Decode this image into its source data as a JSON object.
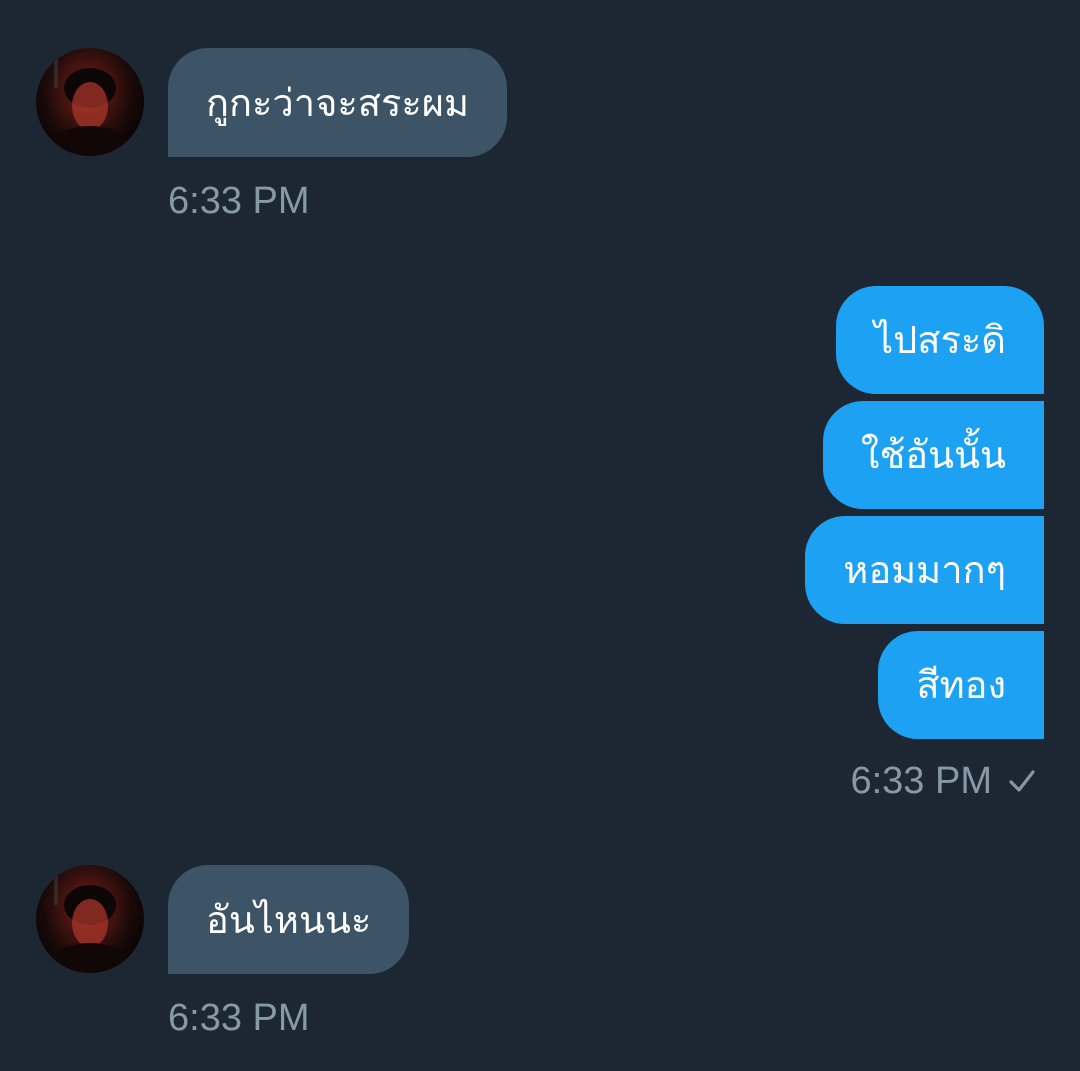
{
  "messages": [
    {
      "direction": "incoming",
      "text": "กูกะว่าจะสระผม",
      "time": "6:33 PM"
    },
    {
      "direction": "outgoing",
      "texts": [
        "ไปสระดิ",
        "ใช้อันนั้น",
        "หอมมากๆ",
        "สีทอง"
      ],
      "time": "6:33 PM",
      "status_icon": "check-icon"
    },
    {
      "direction": "incoming",
      "text": "อันไหนนะ",
      "time": "6:33 PM"
    }
  ],
  "colors": {
    "background": "#1c2733",
    "incoming_bubble": "#3d5466",
    "outgoing_bubble": "#1da1f2",
    "timestamp": "#8899a6"
  }
}
